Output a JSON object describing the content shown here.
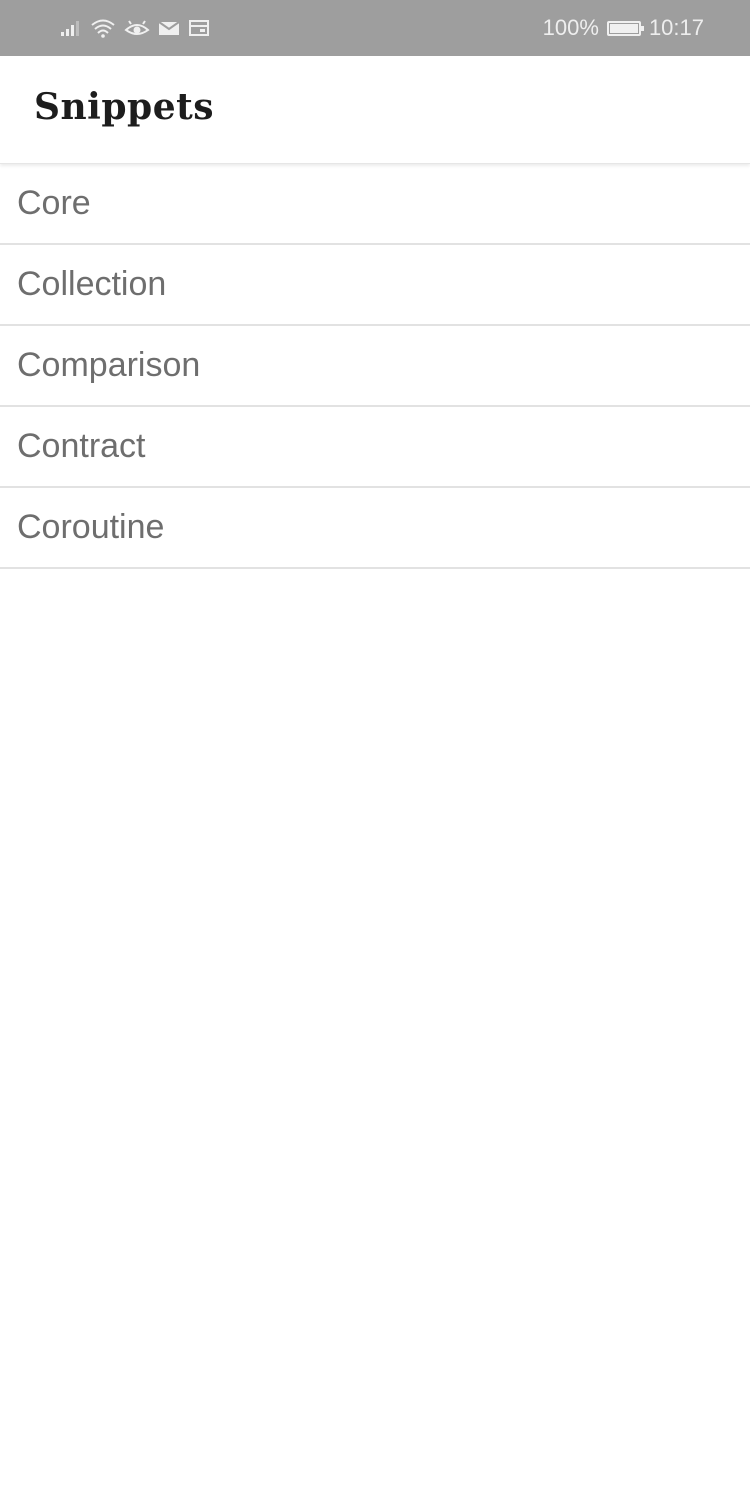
{
  "status_bar": {
    "icons": [
      "signal-icon",
      "wifi-icon",
      "eye-icon",
      "mail-icon",
      "sim-card-icon"
    ],
    "battery_percent": "100%",
    "battery_level": 1.0,
    "time": "10:17"
  },
  "header": {
    "title": "Snippets"
  },
  "list": {
    "items": [
      {
        "label": "Core"
      },
      {
        "label": "Collection"
      },
      {
        "label": "Comparison"
      },
      {
        "label": "Contract"
      },
      {
        "label": "Coroutine"
      }
    ]
  },
  "colors": {
    "status_bar_bg": "#9e9e9e",
    "title_text": "#1d1d1d",
    "item_text": "#6e6e6e",
    "divider": "#e2e2e2"
  }
}
